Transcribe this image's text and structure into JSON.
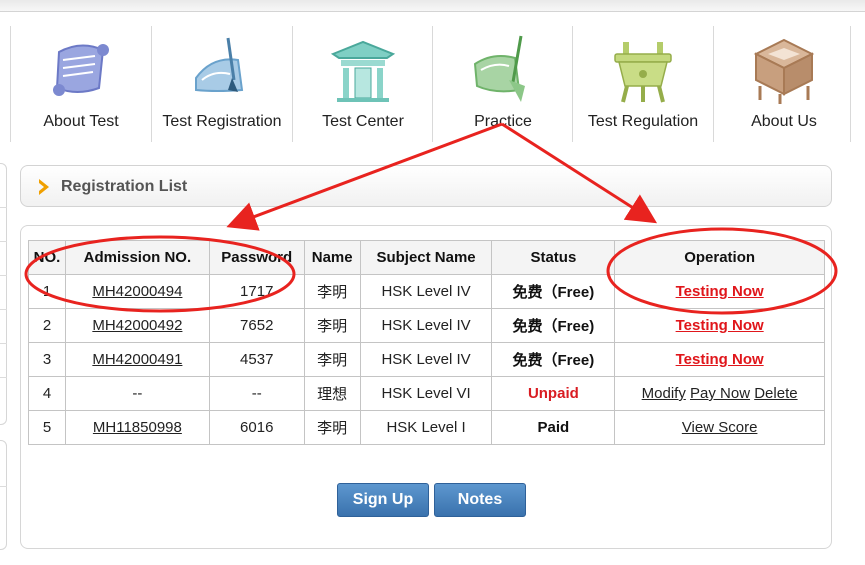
{
  "nav": {
    "items": [
      {
        "label": "About Test",
        "icon": "scroll-icon"
      },
      {
        "label": "Test Registration",
        "icon": "scroll-brush-icon"
      },
      {
        "label": "Test Center",
        "icon": "pavilion-icon"
      },
      {
        "label": "Practice",
        "icon": "scroll-pen-icon"
      },
      {
        "label": "Test Regulation",
        "icon": "bronze-cauldron-icon"
      },
      {
        "label": "About Us",
        "icon": "wooden-box-icon"
      }
    ]
  },
  "section": {
    "title": "Registration List"
  },
  "table": {
    "headers": [
      "NO.",
      "Admission NO.",
      "Password",
      "Name",
      "Subject Name",
      "Status",
      "Operation"
    ],
    "rows": [
      {
        "no": "1",
        "admission": "MH42000494",
        "password": "1717",
        "name": "李明",
        "subject": "HSK Level IV",
        "status": "免费（Free)",
        "op": [
          "Testing Now"
        ]
      },
      {
        "no": "2",
        "admission": "MH42000492",
        "password": "7652",
        "name": "李明",
        "subject": "HSK Level IV",
        "status": "免费（Free)",
        "op": [
          "Testing Now"
        ]
      },
      {
        "no": "3",
        "admission": "MH42000491",
        "password": "4537",
        "name": "李明",
        "subject": "HSK Level IV",
        "status": "免费（Free)",
        "op": [
          "Testing Now"
        ]
      },
      {
        "no": "4",
        "admission": "--",
        "password": "--",
        "name": "理想",
        "subject": "HSK Level VI",
        "status": "Unpaid",
        "op": [
          "Modify",
          "Pay Now",
          "Delete"
        ]
      },
      {
        "no": "5",
        "admission": "MH11850998",
        "password": "6016",
        "name": "李明",
        "subject": "HSK Level I",
        "status": "Paid",
        "op": [
          "View Score"
        ]
      }
    ]
  },
  "buttons": {
    "sign_up": "Sign Up",
    "notes": "Notes"
  },
  "colors": {
    "accent_red": "#e0161b",
    "button_blue": "#4a84c0",
    "chevron": "#f0a000"
  }
}
